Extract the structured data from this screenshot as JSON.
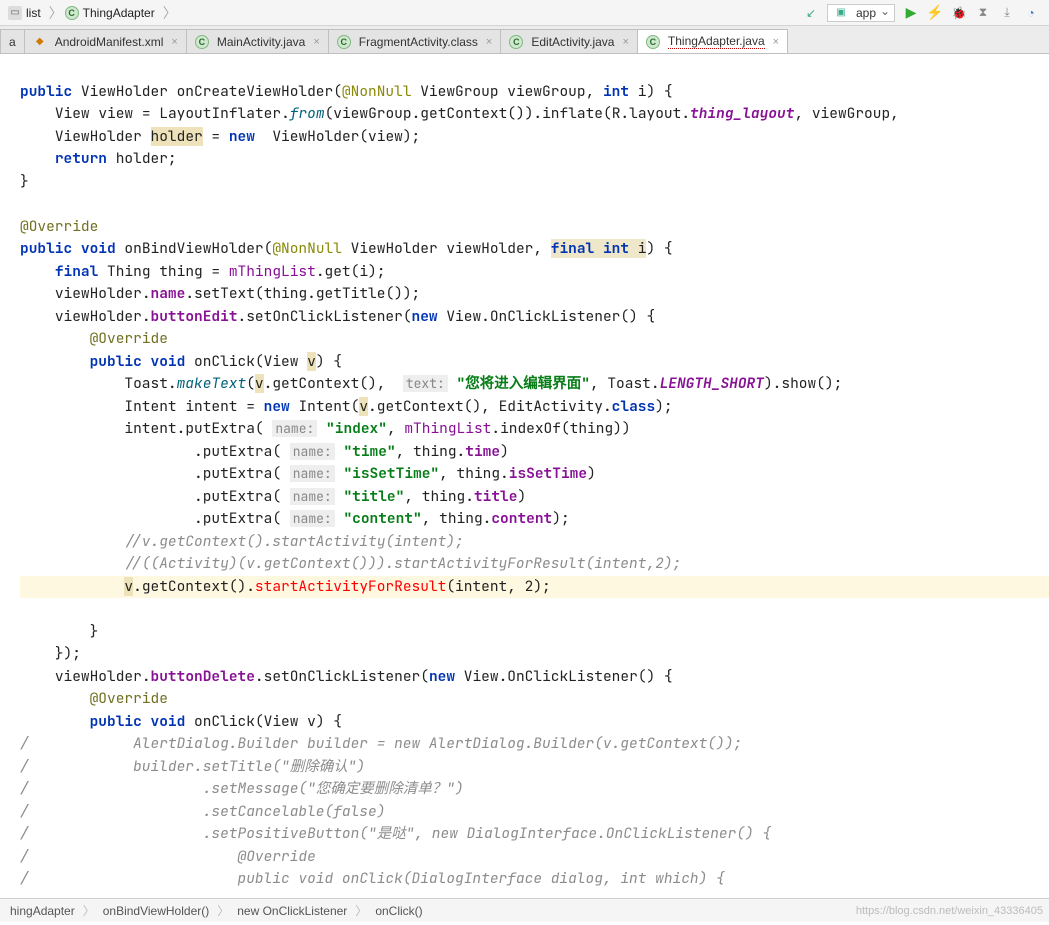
{
  "nav": {
    "crumbs": [
      {
        "icon": "folder",
        "label": "list"
      },
      {
        "icon": "class",
        "label": "ThingAdapter"
      }
    ]
  },
  "run_config": {
    "label": "app"
  },
  "tabs": [
    {
      "id": "a",
      "icon": "java",
      "label": "a",
      "closable": false,
      "active": false
    },
    {
      "id": "manifest",
      "icon": "xml",
      "label": "AndroidManifest.xml",
      "closable": true,
      "active": false
    },
    {
      "id": "main",
      "icon": "class",
      "label": "MainActivity.java",
      "closable": true,
      "active": false
    },
    {
      "id": "frag",
      "icon": "class",
      "label": "FragmentActivity.class",
      "closable": true,
      "active": false
    },
    {
      "id": "edit",
      "icon": "class",
      "label": "EditActivity.java",
      "closable": true,
      "active": false
    },
    {
      "id": "thing",
      "icon": "class",
      "label": "ThingAdapter.java",
      "closable": true,
      "active": true,
      "squiggle": true
    }
  ],
  "status": {
    "crumbs": [
      "hingAdapter",
      "onBindViewHolder()",
      "new OnClickListener",
      "onClick()"
    ],
    "watermark": "https://blog.csdn.net/weixin_43336405"
  },
  "code_tokens": {
    "t_public": "public",
    "t_void": "void",
    "t_int": "int",
    "t_new": "new",
    "t_return": "return",
    "t_final": "final",
    "t_class": "class",
    "t_Override": "@Override",
    "t_NonNull": "@NonNull",
    "t_ViewHolder": "ViewHolder",
    "t_onCreateViewHolder": "onCreateViewHolder",
    "t_ViewGroup": "ViewGroup",
    "t_viewGroup": "viewGroup",
    "t_i": "i",
    "t_View": "View",
    "t_view": "view",
    "t_LayoutInflater": "LayoutInflater",
    "t_from": "from",
    "t_getContext": "getContext",
    "t_inflate": "inflate",
    "t_R": "R",
    "t_layout": "layout",
    "t_thing_layout": "thing_layout",
    "t_holder": "holder",
    "t_onBindViewHolder": "onBindViewHolder",
    "t_Thing": "Thing",
    "t_thing": "thing",
    "t_mThingList": "mThingList",
    "t_get": "get",
    "t_viewHolderVar": "viewHolder",
    "t_name": "name",
    "t_setText": "setText",
    "t_getTitle": "getTitle",
    "t_buttonEdit": "buttonEdit",
    "t_setOnClickListener": "setOnClickListener",
    "t_OnClickListener": "OnClickListener",
    "t_onClick": "onClick",
    "t_v": "v",
    "t_Toast": "Toast",
    "t_makeText": "makeText",
    "hint_text": "text:",
    "str_enter_edit": "\"您将进入编辑界面\"",
    "t_LENGTH_SHORT": "LENGTH_SHORT",
    "t_show": "show",
    "t_Intent": "Intent",
    "t_intent": "intent",
    "t_EditActivity": "EditActivity",
    "t_putExtra": "putExtra",
    "hint_name": "name:",
    "str_index": "\"index\"",
    "t_indexOf": "indexOf",
    "str_time": "\"time\"",
    "t_time": "time",
    "str_isSetTime": "\"isSetTime\"",
    "t_isSetTime": "isSetTime",
    "str_title": "\"title\"",
    "t_title": "title",
    "str_content": "\"content\"",
    "t_content": "content",
    "cmt1": "//v.getContext().startActivity(intent);",
    "cmt2": "//((Activity)(v.getContext())).startActivityForResult(intent,2);",
    "t_startActivityForResult": "startActivityForResult",
    "num_2": "2",
    "t_buttonDelete": "buttonDelete",
    "cmt_b1": "AlertDialog.Builder builder = new AlertDialog.Builder(v.getContext());",
    "cmt_b2": "builder.setTitle(\"删除确认\")",
    "cmt_b3": ".setMessage(\"您确定要删除清单？\")",
    "cmt_b4": ".setCancelable(false)",
    "cmt_b5": ".setPositiveButton(\"是哒\", new DialogInterface.OnClickListener() {",
    "cmt_b6": "@Override",
    "cmt_b7": "public void onClick(DialogInterface dialog, int which) {",
    "slash": "/"
  }
}
